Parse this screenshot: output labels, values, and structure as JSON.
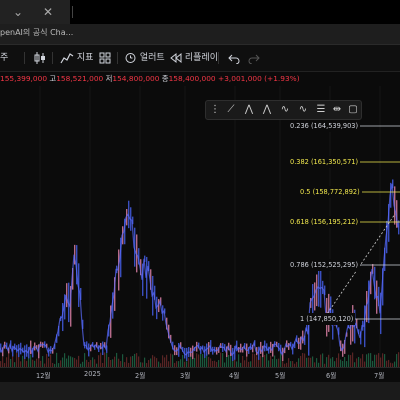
{
  "browser": {
    "address_text": "penAI의 공식 Cha..."
  },
  "toolbar": {
    "interval_label": "주",
    "indicators_label": "지표",
    "alert_label": "얼러트",
    "replay_label": "리플레이"
  },
  "ohlc": {
    "open_value": "155,399,000",
    "high_label": "고",
    "high_value": "158,521,000",
    "low_label": "저",
    "low_value": "154,800,000",
    "close_label": "종",
    "close_value": "158,400,000",
    "change": "+3,001,000 (+1.93%)"
  },
  "fib_levels": [
    {
      "text": "0.236 (164,539,903)",
      "color": "#d1d4dc"
    },
    {
      "text": "0.382 (161,350,571)",
      "color": "#f2e94e"
    },
    {
      "text": "0.5 (158,772,892)",
      "color": "#f2e94e"
    },
    {
      "text": "0.618 (156,195,212)",
      "color": "#f2e94e"
    },
    {
      "text": "0.786 (152,525,295)",
      "color": "#d1d4dc"
    },
    {
      "text": "1 (147,850,120)",
      "color": "#d1d4dc"
    }
  ],
  "x_axis": {
    "ticks": [
      "12월",
      "2025",
      "2월",
      "3월",
      "4월",
      "5월",
      "6월",
      "7월"
    ]
  },
  "colors": {
    "up": "#b76b8a",
    "down": "#3a4fc0",
    "ma_line": "#5b6cff",
    "fib_gold": "#f2e94e",
    "negative": "#f23645"
  },
  "chart_data": {
    "type": "candlestick",
    "x_ticks": [
      "12월",
      "2025",
      "2월",
      "3월",
      "4월",
      "5월",
      "6월",
      "7월"
    ],
    "fib_retracement": [
      {
        "ratio": 0.236,
        "price": 164539903
      },
      {
        "ratio": 0.382,
        "price": 161350571
      },
      {
        "ratio": 0.5,
        "price": 158772892
      },
      {
        "ratio": 0.618,
        "price": 156195212
      },
      {
        "ratio": 0.786,
        "price": 152525295
      },
      {
        "ratio": 1,
        "price": 147850120
      }
    ],
    "last_bar": {
      "open": 155399000,
      "high": 158521000,
      "low": 154800000,
      "close": 158400000,
      "change": 3001000,
      "change_pct": 1.93
    }
  }
}
